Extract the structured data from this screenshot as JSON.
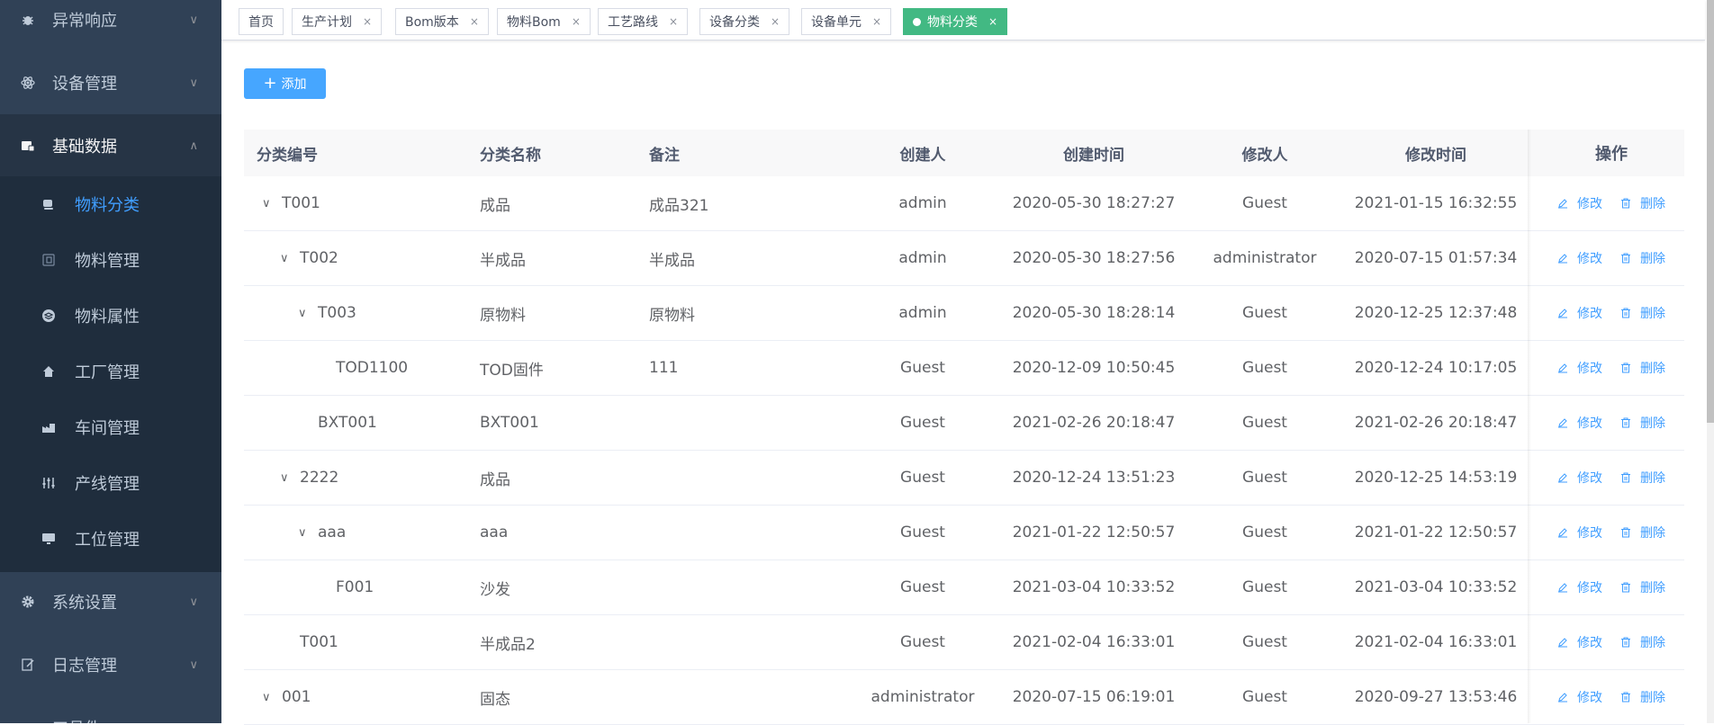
{
  "sidebar": {
    "top_items": [
      {
        "label": "异常响应",
        "icon": "bug-icon"
      },
      {
        "label": "设备管理",
        "icon": "atom-icon"
      },
      {
        "label": "基础数据",
        "icon": "database-icon"
      }
    ],
    "sub_items": [
      {
        "label": "物料分类",
        "icon": "cup-icon",
        "active": true
      },
      {
        "label": "物料管理",
        "icon": "box-icon"
      },
      {
        "label": "物料属性",
        "icon": "layers-icon"
      },
      {
        "label": "工厂管理",
        "icon": "home-icon"
      },
      {
        "label": "车间管理",
        "icon": "factory-icon"
      },
      {
        "label": "产线管理",
        "icon": "sliders-icon"
      },
      {
        "label": "工位管理",
        "icon": "monitor-icon"
      }
    ],
    "bottom_items": [
      {
        "label": "系统设置",
        "icon": "gear-icon"
      },
      {
        "label": "日志管理",
        "icon": "edit-icon"
      },
      {
        "label": "工具件",
        "icon": "tool-icon"
      }
    ]
  },
  "tags": [
    {
      "label": "首页",
      "closable": false
    },
    {
      "label": "生产计划",
      "closable": true
    },
    {
      "label": "Bom版本",
      "closable": true
    },
    {
      "label": "物料Bom",
      "closable": true
    },
    {
      "label": "工艺路线",
      "closable": true
    },
    {
      "label": "设备分类",
      "closable": true
    },
    {
      "label": "设备单元",
      "closable": true
    },
    {
      "label": "物料分类",
      "closable": true,
      "active": true
    }
  ],
  "toolbar": {
    "add_label": "添加"
  },
  "table": {
    "headers": {
      "code": "分类编号",
      "name": "分类名称",
      "remark": "备注",
      "creator": "创建人",
      "ctime": "创建时间",
      "modifier": "修改人",
      "mtime": "修改时间",
      "ops": "操作"
    },
    "edit_label": "修改",
    "delete_label": "删除",
    "rows": [
      {
        "code": "T001",
        "name": "成品",
        "remark": "成品321",
        "creator": "admin",
        "ctime": "2020-05-30 18:27:27",
        "modifier": "Guest",
        "mtime": "2021-01-15 16:32:55",
        "level": 0,
        "expandable": true
      },
      {
        "code": "T002",
        "name": "半成品",
        "remark": "半成品",
        "creator": "admin",
        "ctime": "2020-05-30 18:27:56",
        "modifier": "administrator",
        "mtime": "2020-07-15 01:57:34",
        "level": 1,
        "expandable": true
      },
      {
        "code": "T003",
        "name": "原物料",
        "remark": "原物料",
        "creator": "admin",
        "ctime": "2020-05-30 18:28:14",
        "modifier": "Guest",
        "mtime": "2020-12-25 12:37:48",
        "level": 2,
        "expandable": true
      },
      {
        "code": "TOD1100",
        "name": "TOD固件",
        "remark": "111",
        "creator": "Guest",
        "ctime": "2020-12-09 10:50:45",
        "modifier": "Guest",
        "mtime": "2020-12-24 10:17:05",
        "level": 3,
        "expandable": false
      },
      {
        "code": "BXT001",
        "name": "BXT001",
        "remark": "",
        "creator": "Guest",
        "ctime": "2021-02-26 20:18:47",
        "modifier": "Guest",
        "mtime": "2021-02-26 20:18:47",
        "level": 2,
        "expandable": false
      },
      {
        "code": "2222",
        "name": "成品",
        "remark": "",
        "creator": "Guest",
        "ctime": "2020-12-24 13:51:23",
        "modifier": "Guest",
        "mtime": "2020-12-25 14:53:19",
        "level": 1,
        "expandable": true
      },
      {
        "code": "aaa",
        "name": "aaa",
        "remark": "",
        "creator": "Guest",
        "ctime": "2021-01-22 12:50:57",
        "modifier": "Guest",
        "mtime": "2021-01-22 12:50:57",
        "level": 2,
        "expandable": true
      },
      {
        "code": "F001",
        "name": "沙发",
        "remark": "",
        "creator": "Guest",
        "ctime": "2021-03-04 10:33:52",
        "modifier": "Guest",
        "mtime": "2021-03-04 10:33:52",
        "level": 3,
        "expandable": false
      },
      {
        "code": "T001",
        "name": "半成品2",
        "remark": "",
        "creator": "Guest",
        "ctime": "2021-02-04 16:33:01",
        "modifier": "Guest",
        "mtime": "2021-02-04 16:33:01",
        "level": 1,
        "expandable": false
      },
      {
        "code": "001",
        "name": "固态",
        "remark": "",
        "creator": "administrator",
        "ctime": "2020-07-15 06:19:01",
        "modifier": "Guest",
        "mtime": "2020-09-27 13:53:46",
        "level": 0,
        "expandable": true
      }
    ]
  }
}
